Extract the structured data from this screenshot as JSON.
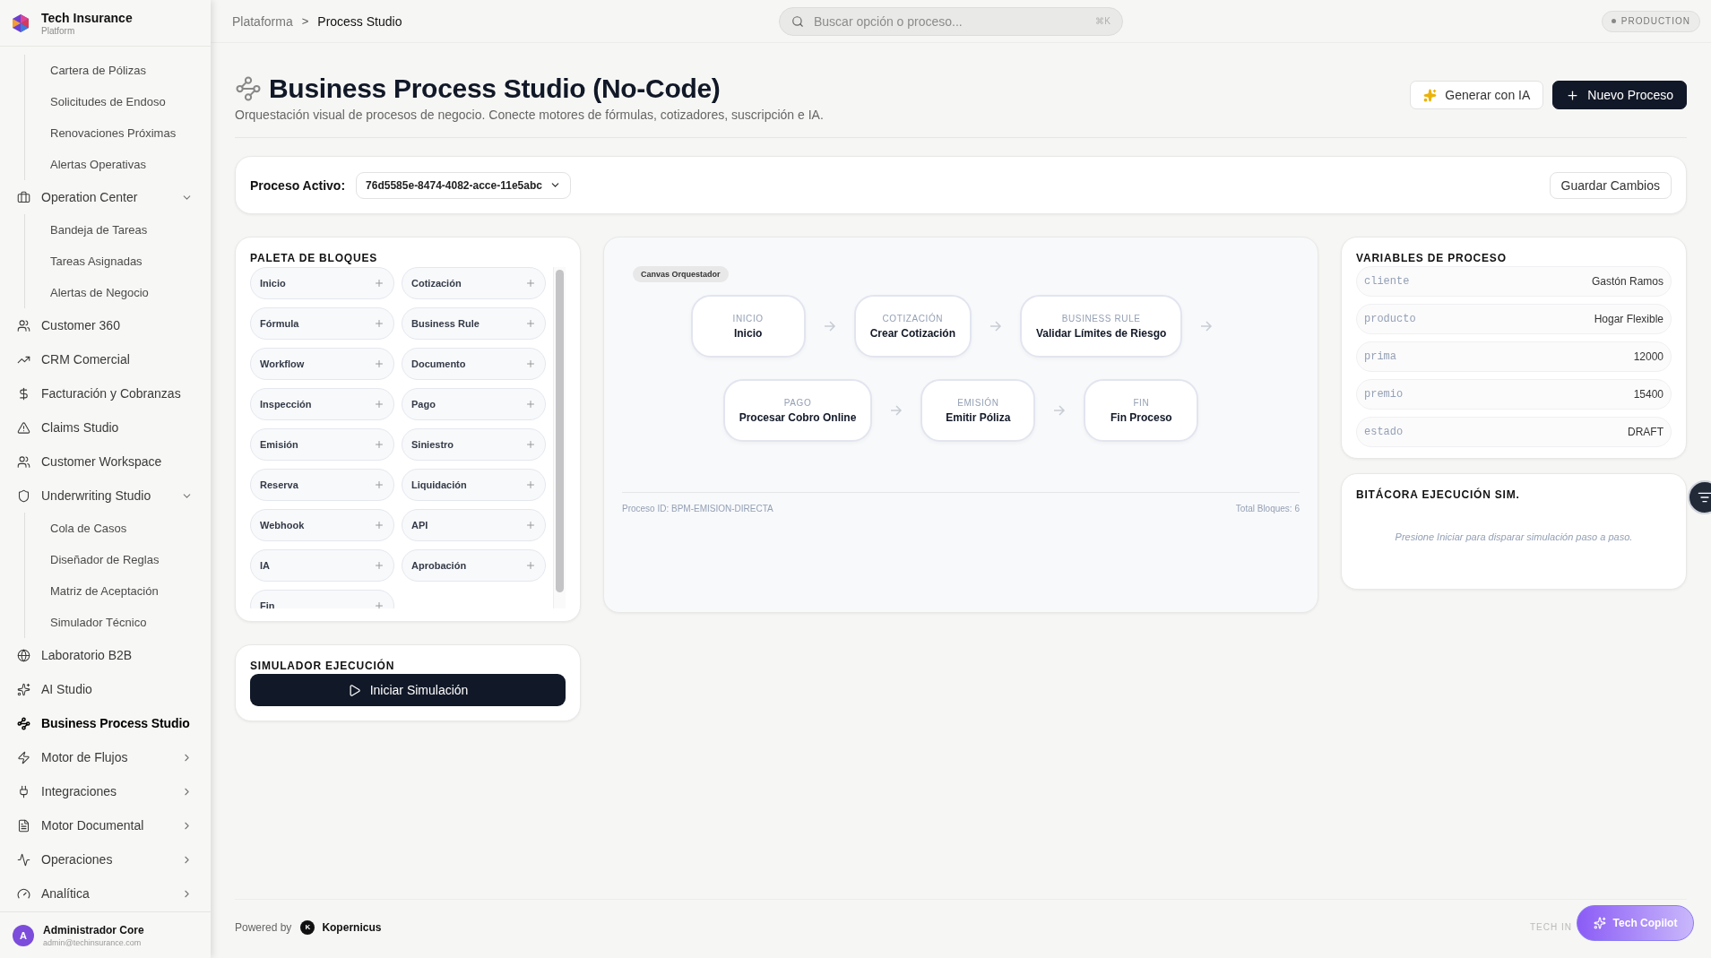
{
  "brand": {
    "name": "Tech Insurance",
    "subtitle": "Platform"
  },
  "sidebar": {
    "items": [
      {
        "kind": "subgroup",
        "children": [
          {
            "label": "Cartera de Pólizas",
            "selected": false
          },
          {
            "label": "Solicitudes de Endoso",
            "selected": false
          },
          {
            "label": "Renovaciones Próximas",
            "selected": false
          },
          {
            "label": "Alertas Operativas",
            "selected": false
          }
        ]
      },
      {
        "kind": "item",
        "label": "Operation Center",
        "selected": false,
        "expanded": true,
        "children": [
          {
            "label": "Bandeja de Tareas",
            "selected": false
          },
          {
            "label": "Tareas Asignadas",
            "selected": false
          },
          {
            "label": "Alertas de Negocio",
            "selected": false
          }
        ]
      },
      {
        "kind": "item",
        "label": "Customer 360",
        "selected": false
      },
      {
        "kind": "item",
        "label": "CRM Comercial",
        "selected": false
      },
      {
        "kind": "item",
        "label": "Facturación y Cobranzas",
        "selected": false
      },
      {
        "kind": "item",
        "label": "Claims Studio",
        "selected": false
      },
      {
        "kind": "item",
        "label": "Customer Workspace",
        "selected": false
      },
      {
        "kind": "item",
        "label": "Underwriting Studio",
        "selected": false,
        "expanded": true,
        "children": [
          {
            "label": "Cola de Casos",
            "selected": false
          },
          {
            "label": "Diseñador de Reglas",
            "selected": false
          },
          {
            "label": "Matriz de Aceptación",
            "selected": false
          },
          {
            "label": "Simulador Técnico",
            "selected": false
          }
        ]
      },
      {
        "kind": "item",
        "label": "Laboratorio B2B",
        "selected": false
      },
      {
        "kind": "item",
        "label": "AI Studio",
        "selected": false
      },
      {
        "kind": "item",
        "label": "Business Process Studio",
        "selected": true
      },
      {
        "kind": "item",
        "label": "Motor de Flujos",
        "selected": false,
        "expanded": false
      },
      {
        "kind": "item",
        "label": "Integraciones",
        "selected": false,
        "expanded": false
      },
      {
        "kind": "item",
        "label": "Motor Documental",
        "selected": false,
        "expanded": false
      },
      {
        "kind": "item",
        "label": "Operaciones",
        "selected": false,
        "expanded": false
      },
      {
        "kind": "item",
        "label": "Analítica",
        "selected": false,
        "expanded": false
      }
    ]
  },
  "user": {
    "initial": "A",
    "name": "Administrador Core",
    "email": "admin@techinsurance.com"
  },
  "breadcrumb": [
    "Plataforma",
    "Process Studio"
  ],
  "breadcrumb_separator": ">",
  "search": {
    "placeholder": "Buscar opción o proceso...",
    "shortcut": "⌘K"
  },
  "environment": "PRODUCTION",
  "page": {
    "title": "Business Process Studio (No-Code)",
    "subtitle": "Orquestación visual de procesos de negocio. Conecte motores de fórmulas, cotizadores, suscripción e IA.",
    "buttons": [
      {
        "label": "Generar con IA",
        "kind": "ai"
      },
      {
        "label": "Nuevo Proceso",
        "kind": "primary"
      }
    ]
  },
  "process_bar": {
    "label": "Proceso Activo:",
    "value": "76d5585e-8474-4082-acce-11e5abc",
    "save": "Guardar Cambios"
  },
  "palette": {
    "title": "PALETA DE BLOQUES",
    "blocks": [
      "Inicio",
      "Cotización",
      "Fórmula",
      "Business Rule",
      "Workflow",
      "Documento",
      "Inspección",
      "Pago",
      "Emisión",
      "Siniestro",
      "Reserva",
      "Liquidación",
      "Webhook",
      "API",
      "IA",
      "Aprobación",
      "Fin"
    ]
  },
  "simulator": {
    "title": "SIMULADOR EJECUCIÓN",
    "button": "Iniciar Simulación"
  },
  "canvas": {
    "badge": "Canvas Orquestador",
    "nodes": [
      {
        "type": "INICIO",
        "name": "Inicio"
      },
      {
        "type": "COTIZACIÓN",
        "name": "Crear Cotización"
      },
      {
        "type": "BUSINESS RULE",
        "name": "Validar Límites de Riesgo"
      },
      {
        "type": "PAGO",
        "name": "Procesar Cobro Online"
      },
      {
        "type": "EMISIÓN",
        "name": "Emitir Póliza"
      },
      {
        "type": "FIN",
        "name": "Fin Proceso"
      }
    ],
    "process_id": "Proceso ID: BPM-EMISION-DIRECTA",
    "total": "Total Bloques: 6"
  },
  "variables": {
    "title": "VARIABLES DE PROCESO",
    "rows": [
      {
        "key": "cliente",
        "value": "Gastón Ramos"
      },
      {
        "key": "producto",
        "value": "Hogar Flexible"
      },
      {
        "key": "prima",
        "value": "12000"
      },
      {
        "key": "premio",
        "value": "15400"
      },
      {
        "key": "estado",
        "value": "DRAFT"
      }
    ]
  },
  "log": {
    "title": "BITÁCORA EJECUCIÓN SIM.",
    "empty": "Presione Iniciar para disparar simulación paso a paso."
  },
  "footer": {
    "powered": "Powered by",
    "logo_letter": "K",
    "company": "Kopernicus",
    "right": "TECH IN"
  },
  "copilot": "Tech Copilot"
}
